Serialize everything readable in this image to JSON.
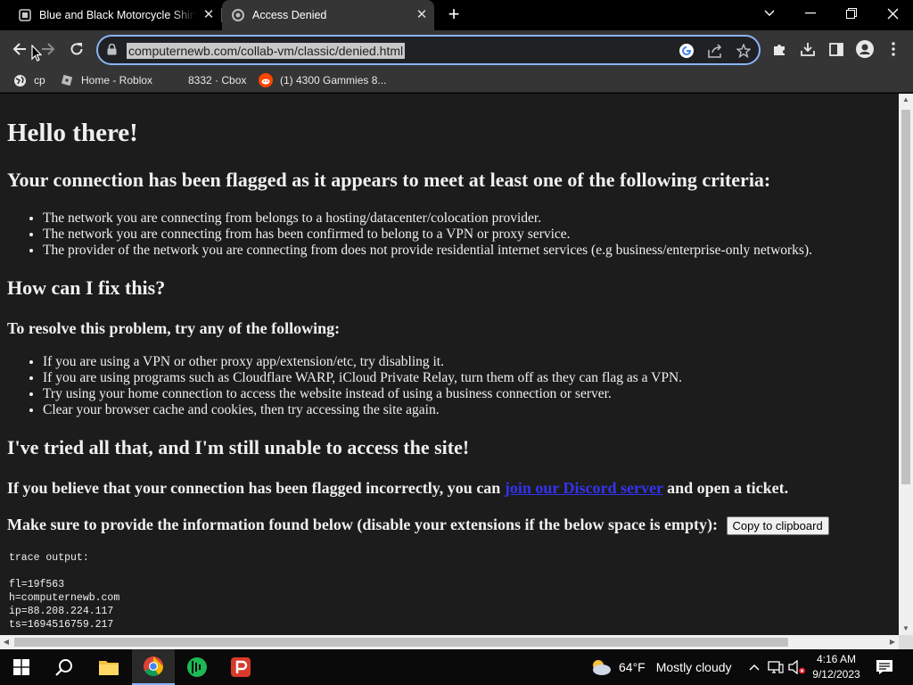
{
  "tabs": [
    {
      "title": "Blue and Black Motorcycle Shirt -"
    },
    {
      "title": "Access Denied"
    }
  ],
  "address_bar": {
    "url": "computernewb.com/collab-vm/classic/denied.html"
  },
  "bookmarks": [
    {
      "label": "cp",
      "icon": "globe-icon"
    },
    {
      "label": "Home - Roblox",
      "icon": "roblox-icon"
    },
    {
      "label": "8332 · Cbox",
      "icon": "none"
    },
    {
      "label": "(1) 4300 Gammies 8...",
      "icon": "reddit-icon"
    }
  ],
  "page": {
    "greeting": "Hello there!",
    "flagged_heading": "Your connection has been flagged as it appears to meet at least one of the following criteria:",
    "criteria": [
      "The network you are connecting from belongs to a hosting/datacenter/colocation provider.",
      "The network you are connecting from has been confirmed to belong to a VPN or proxy service.",
      "The provider of the network you are connecting from does not provide residential internet services (e.g business/enterprise-only networks)."
    ],
    "fix_heading": "How can I fix this?",
    "resolve_heading": "To resolve this problem, try any of the following:",
    "fixes": [
      "If you are using a VPN or other proxy app/extension/etc, try disabling it.",
      "If you are using programs such as Cloudflare WARP, iCloud Private Relay, turn them off as they can flag as a VPN.",
      "Try using your home connection to access the website instead of using a business connection or server.",
      "Clear your browser cache and cookies, then try accessing the site again."
    ],
    "still_heading": "I've tried all that, and I'm still unable to access the site!",
    "incorrect_text_before": "If you believe that your connection has been flagged incorrectly, you can ",
    "incorrect_link": "join our Discord server",
    "incorrect_text_after": " and open a ticket.",
    "provide_text": "Make sure to provide the information found below (disable your extensions if the below space is empty):",
    "copy_button": "Copy to clipboard",
    "trace_label": "trace output:",
    "trace_lines": [
      "fl=19f563",
      "h=computernewb.com",
      "ip=88.208.224.117",
      "ts=1694516759.217"
    ]
  },
  "taskbar": {
    "weather_temp": "64°F",
    "weather_desc": "Mostly cloudy",
    "time": "4:16 AM",
    "date": "9/12/2023"
  },
  "colors": {
    "omnibox_focus": "#8ab4f8",
    "page_background": "#1c1c1c",
    "link": "#3333ee"
  }
}
